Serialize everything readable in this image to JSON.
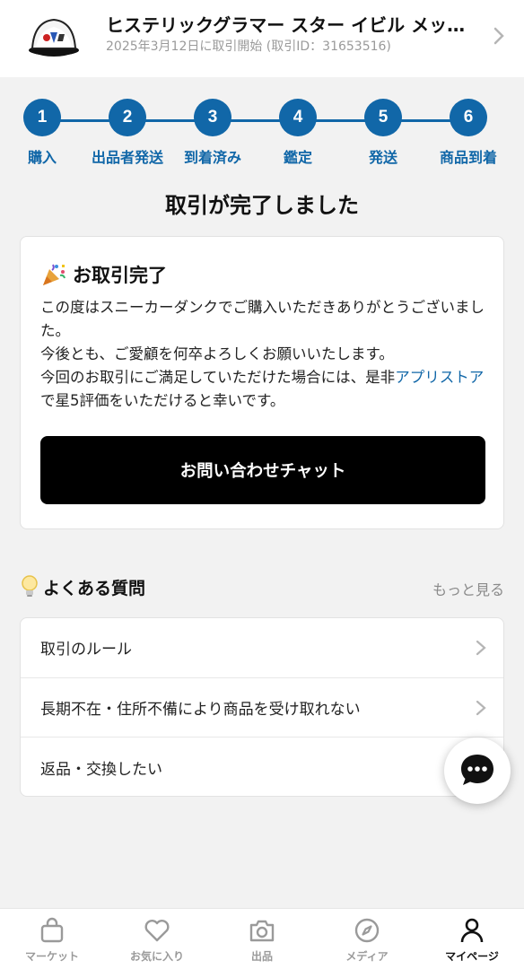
{
  "header": {
    "title": "ヒステリックグラマー スター イビル メッシ…",
    "subtitle": "2025年3月12日に取引開始 (取引ID：31653516)"
  },
  "steps": [
    {
      "num": "1",
      "label": "購入"
    },
    {
      "num": "2",
      "label": "出品者発送"
    },
    {
      "num": "3",
      "label": "到着済み"
    },
    {
      "num": "4",
      "label": "鑑定"
    },
    {
      "num": "5",
      "label": "発送"
    },
    {
      "num": "6",
      "label": "商品到着"
    }
  ],
  "status_title": "取引が完了しました",
  "card": {
    "title": "お取引完了",
    "line1": "この度はスニーカーダンクでご購入いただきありがとうございました。",
    "line2": "今後とも、ご愛顧を何卒よろしくお願いいたします。",
    "line3_pre": "今回のお取引にご満足していただけた場合には、是非",
    "line3_link": "アプリストア",
    "line3_post": "で星5評価をいただけると幸いです。",
    "button": "お問い合わせチャット"
  },
  "faq": {
    "title": "よくある質問",
    "more": "もっと見る",
    "items": [
      {
        "label": "取引のルール"
      },
      {
        "label": "長期不在・住所不備により商品を受け取れない"
      },
      {
        "label": "返品・交換したい"
      }
    ]
  },
  "nav": [
    {
      "label": "マーケット",
      "icon": "bag-icon"
    },
    {
      "label": "お気に入り",
      "icon": "heart-icon"
    },
    {
      "label": "出品",
      "icon": "camera-icon"
    },
    {
      "label": "メディア",
      "icon": "compass-icon"
    },
    {
      "label": "マイページ",
      "icon": "person-icon"
    }
  ],
  "colors": {
    "accent": "#1167a8",
    "button": "#000000",
    "background": "#f2f2f2"
  }
}
